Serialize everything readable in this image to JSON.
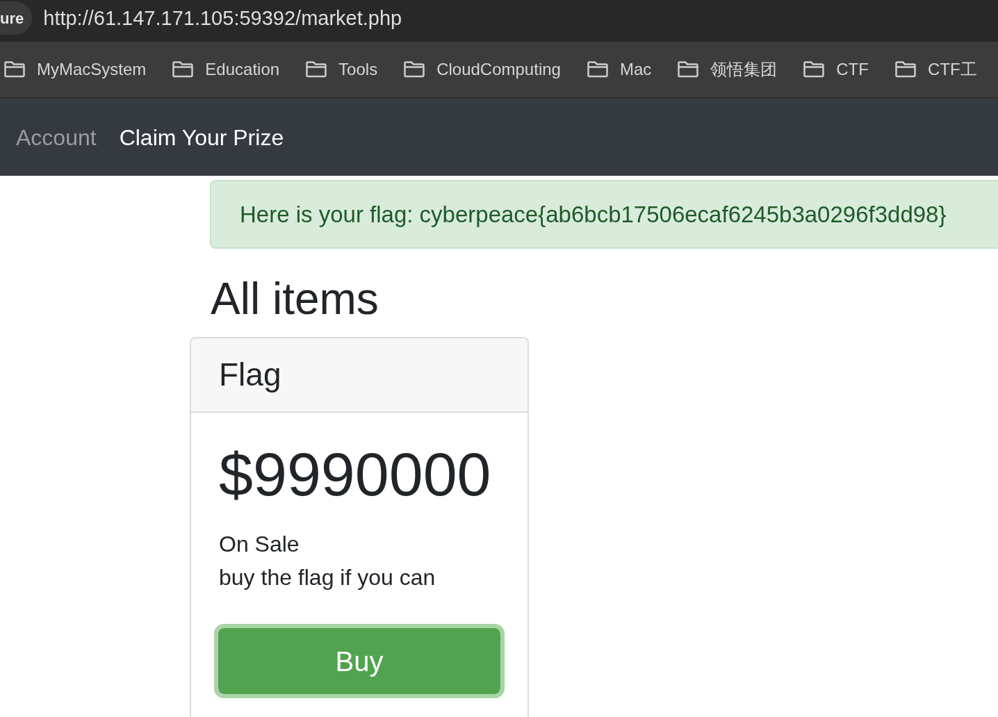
{
  "browser": {
    "site_info": "ure",
    "url": "http://61.147.171.105:59392/market.php"
  },
  "bookmarks": [
    {
      "label": "MyMacSystem"
    },
    {
      "label": "Education"
    },
    {
      "label": "Tools"
    },
    {
      "label": "CloudComputing"
    },
    {
      "label": "Mac"
    },
    {
      "label": "领悟集团"
    },
    {
      "label": "CTF"
    },
    {
      "label": "CTF工"
    }
  ],
  "navbar": {
    "links": [
      {
        "label": "Account",
        "selected": false
      },
      {
        "label": "Claim Your Prize",
        "selected": true
      }
    ]
  },
  "alert": {
    "text": "Here is your flag: cyberpeace{ab6bcb17506ecaf6245b3a0296f3dd98}"
  },
  "heading": "All items",
  "items": [
    {
      "name": "Flag",
      "price": "$9990000",
      "status": "On Sale",
      "description": "buy the flag if you can",
      "button": "Buy",
      "focused": true
    }
  ]
}
